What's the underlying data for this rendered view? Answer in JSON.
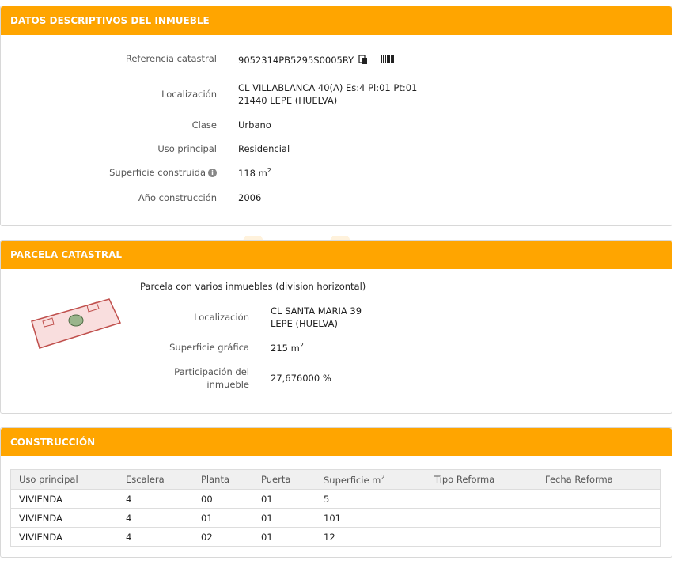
{
  "descriptive": {
    "title": "DATOS DESCRIPTIVOS DEL INMUEBLE",
    "ref_label": "Referencia catastral",
    "ref_value": "9052314PB5295S0005RY",
    "loc_label": "Localización",
    "loc_line1": "CL VILLABLANCA 40(A) Es:4 Pl:01 Pt:01",
    "loc_line2": "21440 LEPE (HUELVA)",
    "clase_label": "Clase",
    "clase_value": "Urbano",
    "uso_label": "Uso principal",
    "uso_value": "Residencial",
    "sup_label": "Superficie construida",
    "sup_value": "118 m",
    "sup_unit_sup": "2",
    "anio_label": "Año construcción",
    "anio_value": "2006"
  },
  "parcela": {
    "title": "PARCELA CATASTRAL",
    "note": "Parcela con varios inmuebles (division horizontal)",
    "loc_label": "Localización",
    "loc_line1": "CL SANTA MARIA 39",
    "loc_line2": "LEPE (HUELVA)",
    "sup_label": "Superficie gráfica",
    "sup_value": "215 m",
    "sup_unit_sup": "2",
    "part_label_line1": "Participación del",
    "part_label_line2": "inmueble",
    "part_value": "27,676000 %"
  },
  "construccion": {
    "title": "CONSTRUCCIÓN",
    "headers": [
      "Uso principal",
      "Escalera",
      "Planta",
      "Puerta",
      "Superficie m",
      "Tipo Reforma",
      "Fecha Reforma"
    ],
    "header_sup": "2",
    "rows": [
      [
        "VIVIENDA",
        "4",
        "00",
        "01",
        "5",
        "",
        ""
      ],
      [
        "VIVIENDA",
        "4",
        "01",
        "01",
        "101",
        "",
        ""
      ],
      [
        "VIVIENDA",
        "4",
        "02",
        "01",
        "12",
        "",
        ""
      ]
    ]
  },
  "colors": {
    "accent": "#ffa500",
    "parcel_fill": "#f9dede",
    "parcel_stroke": "#c0504d"
  }
}
